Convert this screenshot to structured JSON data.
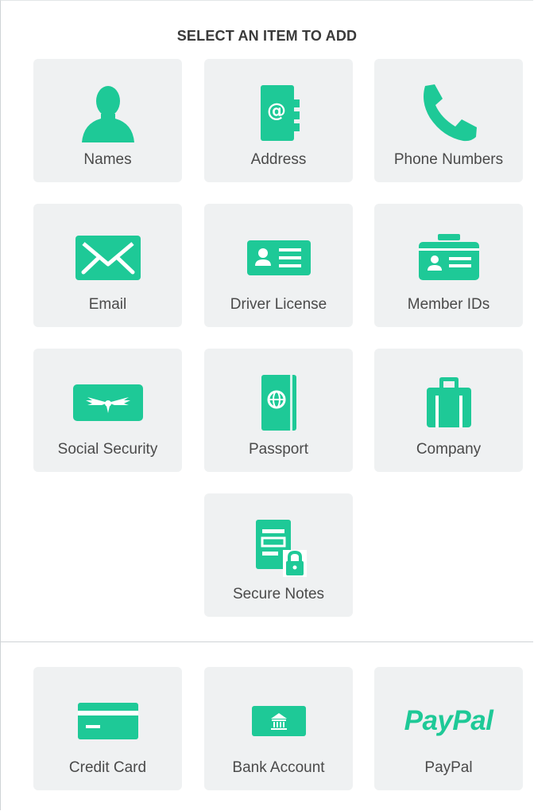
{
  "header": {
    "title": "SELECT AN ITEM TO ADD"
  },
  "items": [
    {
      "label": "Names",
      "icon": "person-icon"
    },
    {
      "label": "Address",
      "icon": "address-book-icon"
    },
    {
      "label": "Phone Numbers",
      "icon": "phone-icon"
    },
    {
      "label": "Email",
      "icon": "envelope-icon"
    },
    {
      "label": "Driver License",
      "icon": "id-card-icon"
    },
    {
      "label": "Member IDs",
      "icon": "badge-icon"
    },
    {
      "label": "Social Security",
      "icon": "winged-card-icon"
    },
    {
      "label": "Passport",
      "icon": "passport-icon"
    },
    {
      "label": "Company",
      "icon": "briefcase-icon"
    },
    {
      "label": "Secure Notes",
      "icon": "locked-note-icon"
    }
  ],
  "payments": [
    {
      "label": "Credit Card",
      "icon": "credit-card-icon"
    },
    {
      "label": "Bank Account",
      "icon": "bank-icon"
    },
    {
      "label": "PayPal",
      "icon": "paypal-logo",
      "logo_text": "PayPal"
    }
  ],
  "colors": {
    "accent": "#1ec997",
    "tile_background": "#eff1f2",
    "label_text": "#4a4a4a"
  }
}
